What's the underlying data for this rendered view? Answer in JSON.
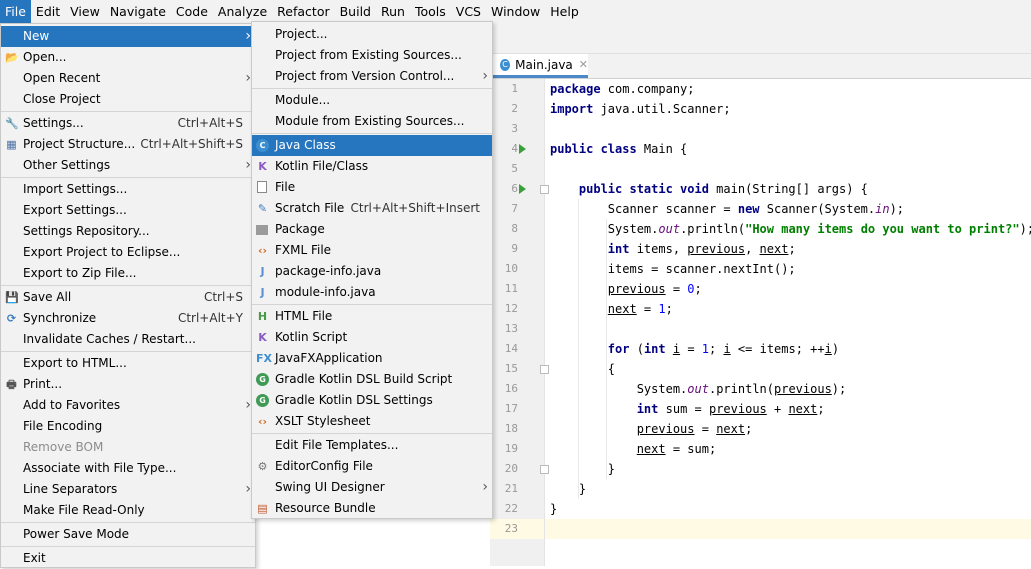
{
  "menubar": [
    "File",
    "Edit",
    "View",
    "Navigate",
    "Code",
    "Analyze",
    "Refactor",
    "Build",
    "Run",
    "Tools",
    "VCS",
    "Window",
    "Help"
  ],
  "file_menu": [
    {
      "label": "New",
      "arrow": true,
      "selected": true
    },
    {
      "label": "Open...",
      "icon": "folder-icon"
    },
    {
      "label": "Open Recent",
      "arrow": true
    },
    {
      "label": "Close Project"
    },
    {
      "sep": true
    },
    {
      "label": "Settings...",
      "shortcut": "Ctrl+Alt+S",
      "icon": "wrench-icon"
    },
    {
      "label": "Project Structure...",
      "shortcut": "Ctrl+Alt+Shift+S",
      "icon": "project-structure-icon"
    },
    {
      "label": "Other Settings",
      "arrow": true
    },
    {
      "sep": true
    },
    {
      "label": "Import Settings..."
    },
    {
      "label": "Export Settings..."
    },
    {
      "label": "Settings Repository..."
    },
    {
      "label": "Export Project to Eclipse..."
    },
    {
      "label": "Export to Zip File..."
    },
    {
      "sep": true
    },
    {
      "label": "Save All",
      "shortcut": "Ctrl+S",
      "icon": "save-icon"
    },
    {
      "label": "Synchronize",
      "shortcut": "Ctrl+Alt+Y",
      "icon": "sync-icon"
    },
    {
      "label": "Invalidate Caches / Restart..."
    },
    {
      "sep": true
    },
    {
      "label": "Export to HTML..."
    },
    {
      "label": "Print...",
      "icon": "print-icon"
    },
    {
      "label": "Add to Favorites",
      "arrow": true
    },
    {
      "label": "File Encoding"
    },
    {
      "label": "Remove BOM",
      "disabled": true
    },
    {
      "label": "Associate with File Type..."
    },
    {
      "label": "Line Separators",
      "arrow": true
    },
    {
      "label": "Make File Read-Only"
    },
    {
      "sep": true
    },
    {
      "label": "Power Save Mode"
    },
    {
      "sep": true
    },
    {
      "label": "Exit"
    }
  ],
  "new_menu": [
    {
      "label": "Project..."
    },
    {
      "label": "Project from Existing Sources..."
    },
    {
      "label": "Project from Version Control...",
      "arrow": true
    },
    {
      "sep": true
    },
    {
      "label": "Module..."
    },
    {
      "label": "Module from Existing Sources..."
    },
    {
      "sep": true
    },
    {
      "label": "Java Class",
      "icon": "java-class-icon",
      "selected": true
    },
    {
      "label": "Kotlin File/Class",
      "icon": "kotlin-icon"
    },
    {
      "label": "File",
      "icon": "file-icon"
    },
    {
      "label": "Scratch File",
      "shortcut": "Ctrl+Alt+Shift+Insert",
      "icon": "scratch-file-icon"
    },
    {
      "label": "Package",
      "icon": "package-icon"
    },
    {
      "label": "FXML File",
      "icon": "fxml-icon"
    },
    {
      "label": "package-info.java",
      "icon": "java-file-icon"
    },
    {
      "label": "module-info.java",
      "icon": "java-file-icon"
    },
    {
      "sep": true
    },
    {
      "label": "HTML File",
      "icon": "html-file-icon"
    },
    {
      "label": "Kotlin Script",
      "icon": "kotlin-script-icon"
    },
    {
      "label": "JavaFXApplication",
      "icon": "javafx-icon"
    },
    {
      "label": "Gradle Kotlin DSL Build Script",
      "icon": "gradle-icon"
    },
    {
      "label": "Gradle Kotlin DSL Settings",
      "icon": "gradle-icon"
    },
    {
      "label": "XSLT Stylesheet",
      "icon": "xslt-icon"
    },
    {
      "sep": true
    },
    {
      "label": "Edit File Templates..."
    },
    {
      "label": "EditorConfig File",
      "icon": "gear-icon"
    },
    {
      "label": "Swing UI Designer",
      "arrow": true
    },
    {
      "label": "Resource Bundle",
      "icon": "resource-bundle-icon"
    }
  ],
  "editor": {
    "tab_label": "Main.java",
    "current_line": 23,
    "run_markers": [
      4,
      6
    ],
    "fold_markers": [
      6,
      15,
      20
    ],
    "lines": [
      [
        [
          "kw",
          "package"
        ],
        [
          "t",
          " com.company;"
        ]
      ],
      [
        [
          "kw",
          "import"
        ],
        [
          "t",
          " java.util.Scanner;"
        ]
      ],
      [],
      [
        [
          "kw",
          "public class"
        ],
        [
          "t",
          " Main {"
        ]
      ],
      [],
      [
        [
          "t",
          "    "
        ],
        [
          "kw",
          "public static void"
        ],
        [
          "t",
          " main(String[] args) {"
        ]
      ],
      [
        [
          "t",
          "        Scanner scanner = "
        ],
        [
          "kw",
          "new"
        ],
        [
          "t",
          " Scanner(System."
        ],
        [
          "fld",
          "in"
        ],
        [
          "t",
          ");"
        ]
      ],
      [
        [
          "t",
          "        System."
        ],
        [
          "fld",
          "out"
        ],
        [
          "t",
          ".println("
        ],
        [
          "st",
          "\"How many items do you want to print?\""
        ],
        [
          "t",
          ");"
        ]
      ],
      [
        [
          "t",
          "        "
        ],
        [
          "kw",
          "int"
        ],
        [
          "t",
          " items, "
        ],
        [
          "ul",
          "previous"
        ],
        [
          "t",
          ", "
        ],
        [
          "ul",
          "next"
        ],
        [
          "t",
          ";"
        ]
      ],
      [
        [
          "t",
          "        items = scanner.nextInt();"
        ]
      ],
      [
        [
          "t",
          "        "
        ],
        [
          "ul",
          "previous"
        ],
        [
          "t",
          " = "
        ],
        [
          "num",
          "0"
        ],
        [
          "t",
          ";"
        ]
      ],
      [
        [
          "t",
          "        "
        ],
        [
          "ul",
          "next"
        ],
        [
          "t",
          " = "
        ],
        [
          "num",
          "1"
        ],
        [
          "t",
          ";"
        ]
      ],
      [],
      [
        [
          "t",
          "        "
        ],
        [
          "kw",
          "for"
        ],
        [
          "t",
          " ("
        ],
        [
          "kw",
          "int"
        ],
        [
          "t",
          " "
        ],
        [
          "ul",
          "i"
        ],
        [
          "t",
          " = "
        ],
        [
          "num",
          "1"
        ],
        [
          "t",
          "; "
        ],
        [
          "ul",
          "i"
        ],
        [
          "t",
          " <= items; ++"
        ],
        [
          "ul",
          "i"
        ],
        [
          "t",
          ")"
        ]
      ],
      [
        [
          "t",
          "        {"
        ]
      ],
      [
        [
          "t",
          "            System."
        ],
        [
          "fld",
          "out"
        ],
        [
          "t",
          ".println("
        ],
        [
          "ul",
          "previous"
        ],
        [
          "t",
          ");"
        ]
      ],
      [
        [
          "t",
          "            "
        ],
        [
          "kw",
          "int"
        ],
        [
          "t",
          " sum = "
        ],
        [
          "ul",
          "previous"
        ],
        [
          "t",
          " + "
        ],
        [
          "ul",
          "next"
        ],
        [
          "t",
          ";"
        ]
      ],
      [
        [
          "t",
          "            "
        ],
        [
          "ul",
          "previous"
        ],
        [
          "t",
          " = "
        ],
        [
          "ul",
          "next"
        ],
        [
          "t",
          ";"
        ]
      ],
      [
        [
          "t",
          "            "
        ],
        [
          "ul",
          "next"
        ],
        [
          "t",
          " = sum;"
        ]
      ],
      [
        [
          "t",
          "        }"
        ]
      ],
      [
        [
          "t",
          "    }"
        ]
      ],
      [
        [
          "t",
          "}"
        ]
      ],
      []
    ]
  },
  "colors": {
    "selection": "#2675bf",
    "keyword": "#000080",
    "string": "#008000",
    "field": "#660e7a",
    "number": "#0000ff"
  }
}
